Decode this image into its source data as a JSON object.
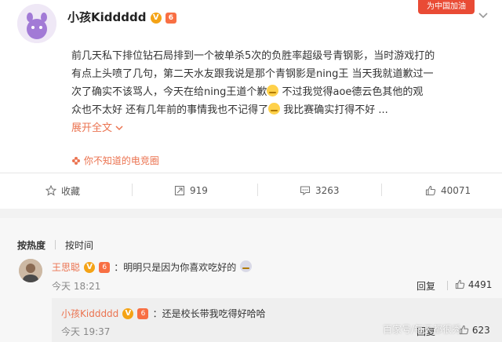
{
  "post": {
    "username": "小孩Kiddddd",
    "v_badge": "V",
    "fan_badge": "6",
    "corner_badge": "为中国加油",
    "text_lines": [
      "前几天私下排位钻石局排到一个被单杀5次的负胜率超级号青钢影，当时游戏打的",
      "有点上头喷了几句，第二天水友跟我说是那个青钢影是ning王 当天我就道歉过一",
      "次了确实不该骂人，今天在给ning王道个歉",
      "众也不太好 还有几年前的事情我也不记得了",
      "展开全文"
    ],
    "line3_tail": " 不过我觉得aoe德云色其他的观",
    "line4_tail": " 我比赛确实打得不好 ...",
    "expand_label": "展开全文",
    "expand_icon": "chevron-down",
    "topic": "你不知道的电竞圈"
  },
  "actions": {
    "favorite": {
      "label": "收藏",
      "icon": "star-icon"
    },
    "repost": {
      "label": "919",
      "icon": "repost-icon"
    },
    "comment": {
      "label": "3263",
      "icon": "comment-icon"
    },
    "like": {
      "label": "40071",
      "icon": "thumb-up-icon"
    }
  },
  "sort_tabs": {
    "hot": "按热度",
    "time": "按时间"
  },
  "comment": {
    "name": "王思聪",
    "v_badge": "V",
    "fan_badge": "6",
    "text": "：明明只是因为你喜欢吃好的",
    "time": "今天 18:21",
    "reply_label": "回复",
    "likes": "4491"
  },
  "reply": {
    "name": "小孩Kiddddd",
    "v_badge": "V",
    "fan_badge": "6",
    "text": "：还是校长带我吃得好哈哈",
    "time": "今天 19:37",
    "reply_label": "回复",
    "likes": "623"
  },
  "watermark": "百家号/每天都很秀",
  "colors": {
    "accent": "#eb7350",
    "badge": "#f4a316"
  }
}
